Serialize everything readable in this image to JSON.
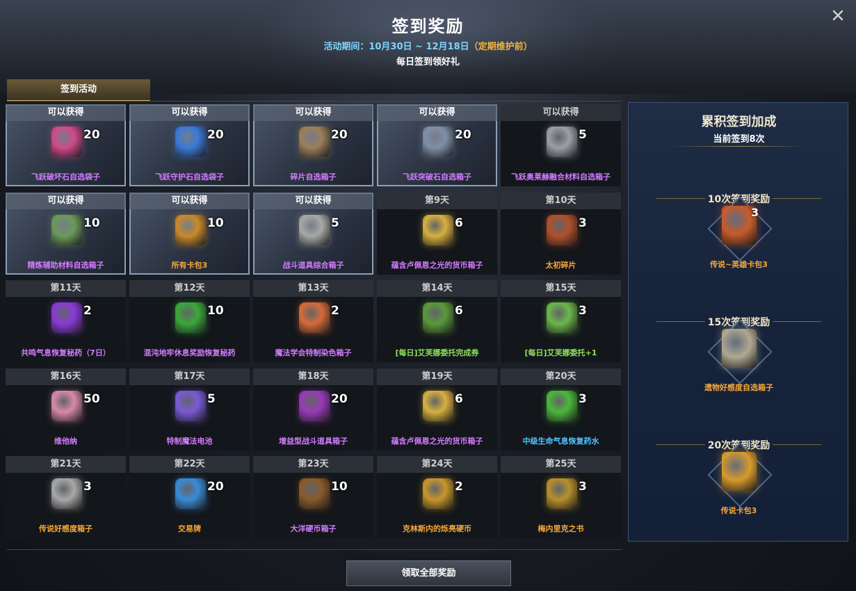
{
  "window": {
    "title": "签到奖励",
    "period_label": "活动期间：",
    "period_value": "10月30日 ~ 12月18日",
    "period_note": "（定期维护前）",
    "subtitle": "每日签到领好礼",
    "close_icon": "close-icon"
  },
  "tab": {
    "label": "签到活动"
  },
  "cells": [
    {
      "header": "可以获得",
      "qty": "20",
      "name": "飞跃破坏石自选袋子",
      "rarity": "purple",
      "claimed": true,
      "icon": "pink-pouch-icon",
      "icon_color": "#d04a8a"
    },
    {
      "header": "可以获得",
      "qty": "20",
      "name": "飞跃守护石自选袋子",
      "rarity": "purple",
      "claimed": true,
      "icon": "blue-pouch-icon",
      "icon_color": "#3a7ad8"
    },
    {
      "header": "可以获得",
      "qty": "20",
      "name": "碎片自选箱子",
      "rarity": "purple",
      "claimed": true,
      "icon": "chest-icon",
      "icon_color": "#9b7f5a"
    },
    {
      "header": "可以获得",
      "qty": "20",
      "name": "飞跃突破石自选箱子",
      "rarity": "purple",
      "claimed": true,
      "icon": "chest-icon",
      "icon_color": "#7f8fa8"
    },
    {
      "header": "可以获得",
      "qty": "5",
      "name": "飞跃奥莱赫融合材料自选箱子",
      "rarity": "purple",
      "claimed": false,
      "icon": "chest-icon",
      "icon_color": "#9aa0a6"
    },
    {
      "header": "可以获得",
      "qty": "10",
      "name": "精炼辅助材料自选箱子",
      "rarity": "purple",
      "claimed": true,
      "icon": "green-chest-icon",
      "icon_color": "#6a9a5a"
    },
    {
      "header": "可以获得",
      "qty": "10",
      "name": "所有卡包3",
      "rarity": "orange",
      "claimed": true,
      "icon": "card-pack-icon",
      "icon_color": "#c98a2a"
    },
    {
      "header": "可以获得",
      "qty": "5",
      "name": "战斗道具综合箱子",
      "rarity": "purple",
      "claimed": true,
      "icon": "chest-icon",
      "icon_color": "#a8a8a8"
    },
    {
      "header": "第9天",
      "qty": "6",
      "name": "蕴含卢佩恩之光的货币箱子",
      "rarity": "purple",
      "claimed": false,
      "icon": "gold-chest-icon",
      "icon_color": "#d8b040"
    },
    {
      "header": "第10天",
      "qty": "3",
      "name": "太初碎片",
      "rarity": "orange",
      "claimed": false,
      "icon": "fragment-card-icon",
      "icon_color": "#b0502a"
    },
    {
      "header": "第11天",
      "qty": "2",
      "name": "共鸣气息恢复秘药（7日）",
      "rarity": "purple",
      "claimed": false,
      "icon": "potion-icon",
      "icon_color": "#8a3ad8"
    },
    {
      "header": "第12天",
      "qty": "10",
      "name": "混沌地牢休息奖励恢复秘药",
      "rarity": "purple",
      "claimed": false,
      "icon": "green-orb-icon",
      "icon_color": "#3aa83a"
    },
    {
      "header": "第13天",
      "qty": "2",
      "name": "魔法学会特制染色箱子",
      "rarity": "purple",
      "claimed": false,
      "icon": "gift-box-icon",
      "icon_color": "#d86a3a"
    },
    {
      "header": "第14天",
      "qty": "6",
      "name": "[每日]艾芙娜委托完成券",
      "rarity": "green",
      "claimed": false,
      "icon": "scroll-icon",
      "icon_color": "#5a9a3a"
    },
    {
      "header": "第15天",
      "qty": "3",
      "name": "[每日]艾芙娜委托+1",
      "rarity": "green",
      "claimed": false,
      "icon": "emblem-icon",
      "icon_color": "#6ab84a"
    },
    {
      "header": "第16天",
      "qty": "50",
      "name": "维他纳",
      "rarity": "purple",
      "claimed": false,
      "icon": "food-can-icon",
      "icon_color": "#d88aa8"
    },
    {
      "header": "第17天",
      "qty": "5",
      "name": "特制魔法电池",
      "rarity": "purple",
      "claimed": false,
      "icon": "battery-icon",
      "icon_color": "#7a5ad8"
    },
    {
      "header": "第18天",
      "qty": "20",
      "name": "增益型战斗道具箱子",
      "rarity": "purple",
      "claimed": false,
      "icon": "purple-chest-icon",
      "icon_color": "#9a3ab8"
    },
    {
      "header": "第19天",
      "qty": "6",
      "name": "蕴含卢佩恩之光的货币箱子",
      "rarity": "purple",
      "claimed": false,
      "icon": "gold-chest-icon",
      "icon_color": "#d8b040"
    },
    {
      "header": "第20天",
      "qty": "3",
      "name": "中级生命气息恢复药水",
      "rarity": "blue",
      "claimed": false,
      "icon": "green-potion-icon",
      "icon_color": "#4ab83a"
    },
    {
      "header": "第21天",
      "qty": "3",
      "name": "传说好感度箱子",
      "rarity": "orange",
      "claimed": false,
      "icon": "chest-icon",
      "icon_color": "#a8a8a8"
    },
    {
      "header": "第22天",
      "qty": "20",
      "name": "交易牌",
      "rarity": "orange",
      "claimed": false,
      "icon": "blue-disc-icon",
      "icon_color": "#3a8ad8"
    },
    {
      "header": "第23天",
      "qty": "10",
      "name": "大洋硬币箱子",
      "rarity": "purple",
      "claimed": false,
      "icon": "wood-chest-icon",
      "icon_color": "#8a5a2a"
    },
    {
      "header": "第24天",
      "qty": "2",
      "name": "克林斯内的烁亮硬币",
      "rarity": "orange",
      "claimed": false,
      "icon": "gold-coin-icon",
      "icon_color": "#c8962a"
    },
    {
      "header": "第25天",
      "qty": "3",
      "name": "梅内里克之书",
      "rarity": "orange",
      "claimed": false,
      "icon": "book-icon",
      "icon_color": "#b8902a"
    }
  ],
  "sidebar": {
    "title": "累积签到加成",
    "current": "当前签到8次",
    "milestones": [
      {
        "label": "10次签到奖励",
        "qty": "3",
        "name": "传说~英雄卡包3",
        "icon": "card-pack-icon",
        "icon_color": "#c85a2a"
      },
      {
        "label": "15次签到奖励",
        "qty": "",
        "name": "遗物好感度自选箱子",
        "icon": "chest-icon",
        "icon_color": "#b0a890"
      },
      {
        "label": "20次签到奖励",
        "qty": "",
        "name": "传说卡包3",
        "icon": "book-icon",
        "icon_color": "#d89a2a"
      }
    ]
  },
  "footer": {
    "claim_all": "领取全部奖励"
  }
}
